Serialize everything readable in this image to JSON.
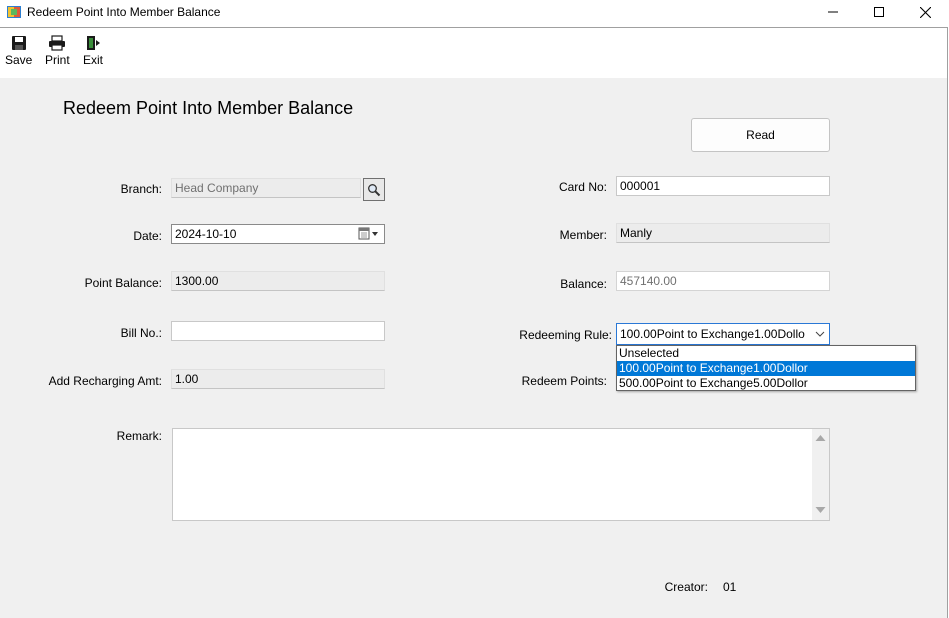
{
  "window": {
    "title": "Redeem Point Into Member Balance"
  },
  "toolbar": {
    "save_label": "Save",
    "print_label": "Print",
    "exit_label": "Exit"
  },
  "page": {
    "title": "Redeem Point Into Member Balance",
    "read_button": "Read"
  },
  "form": {
    "branch_label": "Branch:",
    "branch_value": "Head Company",
    "date_label": "Date:",
    "date_value": "2024-10-10",
    "point_balance_label": "Point Balance:",
    "point_balance_value": "1300.00",
    "bill_no_label": "Bill No.:",
    "bill_no_value": "",
    "add_recharging_label": "Add Recharging Amt:",
    "add_recharging_value": "1.00",
    "card_no_label": "Card No:",
    "card_no_value": "000001",
    "member_label": "Member:",
    "member_value": "Manly",
    "balance_label": "Balance:",
    "balance_value": "457140.00",
    "redeeming_rule_label": "Redeeming Rule:",
    "redeeming_rule_value": "100.00Point to Exchange1.00Dollo",
    "redeem_points_label": "Redeem Points:",
    "remark_label": "Remark:",
    "remark_value": "",
    "creator_label": "Creator:",
    "creator_value": "01"
  },
  "rule_options": [
    {
      "label": "Unselected",
      "selected": false
    },
    {
      "label": "100.00Point to Exchange1.00Dollor",
      "selected": true
    },
    {
      "label": "500.00Point to Exchange5.00Dollor",
      "selected": false
    }
  ],
  "colors": {
    "highlight": "#0078d7",
    "focus_border": "#2a78d6",
    "content_bg": "#f0f0f0"
  }
}
